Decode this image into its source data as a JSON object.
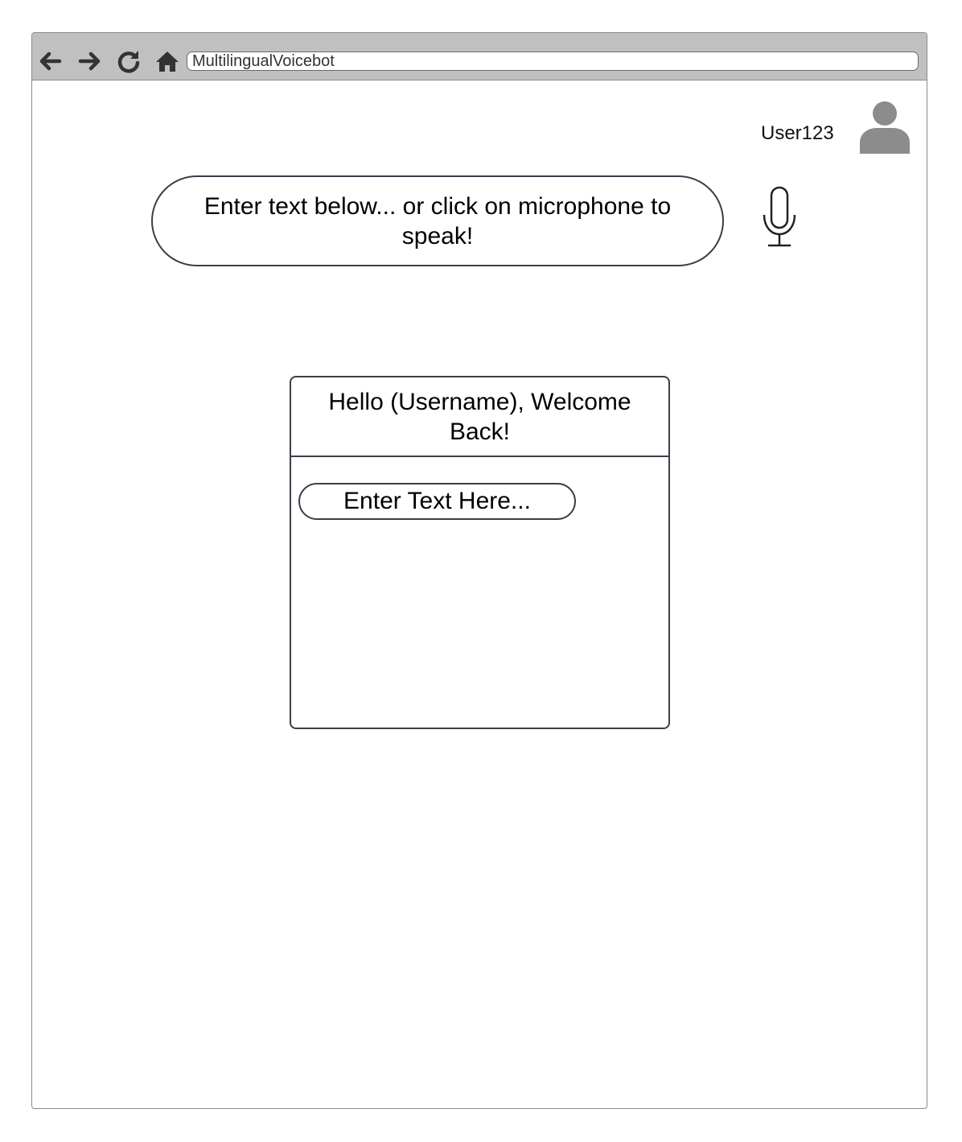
{
  "browser": {
    "address": "MultilingualVoicebot",
    "icons": [
      "back-arrow-icon",
      "forward-arrow-icon",
      "reload-icon",
      "home-icon"
    ]
  },
  "header": {
    "username": "User123",
    "avatar_icon": "user-avatar-icon"
  },
  "prompt": {
    "text": "Enter text below... or click on microphone to speak!",
    "mic_icon": "microphone-icon"
  },
  "chat": {
    "greeting": "Hello (Username), Welcome Back!",
    "input_placeholder": "Enter Text Here..."
  },
  "colors": {
    "toolbar": "#c0c0c0",
    "border": "#3a3f48",
    "icon": "#333333",
    "avatar": "#8c8c8c"
  }
}
